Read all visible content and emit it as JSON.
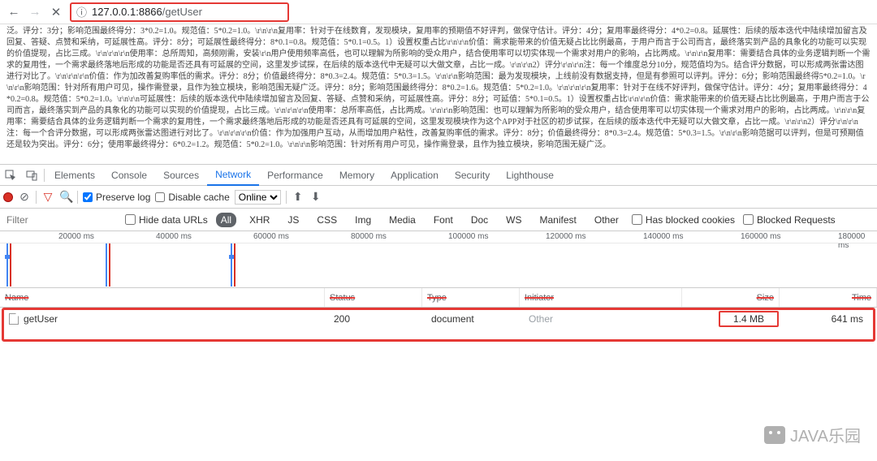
{
  "address_bar": {
    "url_host": "127.0.0.1",
    "url_port": ":8866",
    "url_path": "/getUser"
  },
  "page_content": "泛。评分：3分；影响范围最终得分：3*0.2=1.0。规范值：5*0.2=1.0。\\r\\n\\r\\n复用率：针对于在线数育，发现模块，复用率的预期值不好评判，做保守估计。评分：4分；复用率最终得分：4*0.2=0.8。延展性：后续的版本迭代中陆续增加留言及回复、答疑、点赞和采纳，可延展性高。评分：8分；可延展性最终得分：8*0.1=0.8。规范值：5*0.1=0.5。1）设置权重占比\\r\\n\\r\\n价值：需求能带来的价值无疑占比比例最高，于用户而言于公司而言，最终落实到产品的具象化的功能可以实现的价值提现，占比三成。\\r\\n\\r\\n\\r\\n使用率：总所周知，高频刚需，安装\\r\\n用户使用频率高低，也可以理解为所影响的受众用户，结合使用率可以切实体现一个需求对用户的影响，占比两成。\\r\\n\\r\\n复用率：需要结合具体的业务逻辑判断一个需求的复用性，一个需求最终落地后形成的功能是否还具有可延展的空间，这里发步试探，在后续的版本迭代中无疑可以大做文章，占比一成。\\r\\n\\r\\n2）评分\\r\\n\\r\\n注：每一个维度总分10分，规范值均为5。结合评分数据，可以形成两张雷达图进行对比了。\\r\\n\\r\\n\\r\\n价值：作为加改善复购率低的需求。评分：8分；价值最终得分：8*0.3=2.4。规范值：5*0.3=1.5。\\r\\n\\r\\n影响范围：最为发现模块，上线前没有数据支持，但是有参照可以评判。评分：6分；影响范围最终得5*0.2=1.0。\\r\\n\\r\\n影响范围：针对所有用户可见，操作需登录，且作为独立模块，影响范围无疑广泛。评分：8分；影响范围最终得分：8*0.2=1.6。规范值：5*0.2=1.0。\\r\\n\\r\\n\\r\\n复用率：针对于在线不好评判，做保守估计。评分：4分；复用率最终得分：4*0.2=0.8。规范值：5*0.2=1.0。\\r\\n\\r\\n可延展性：后续的版本迭代中陆续增加留言及回复、答疑、点赞和采纳，可延展性高。评分：8分；可延值：5*0.1=0.5。1）设置权重占比\\r\\n\\r\\n价值：需求能带来的价值无疑占比比例最高，于用户而言于公司而言，最终落实到产品的具象化的功能可以实现的价值提现，占比三成。\\r\\n\\r\\n\\r\\n使用率：总所率高低，占比两成。\\r\\n\\r\\n影响范围：也可以理解为所影响的受众用户，结合使用率可以切实体现一个需求对用户的影响，占比两成。\\r\\n\\r\\n复用率：需要结合具体的业务逻辑判断一个需求的复用性，一个需求最终落地后形成的功能是否还具有可延展的空间，这里发现模块作为这个APP对于社区的初步试探，在后续的版本迭代中无疑可以大做文章，占比一成。\\r\\n\\r\\n2）评分\\r\\n\\r\\n注：每一个合评分数据，可以形成两张雷达图进行对比了。\\r\\n\\r\\n\\r\\n价值：作为加强用户互动，从而增加用户粘性，改善复购率低的需求。评分：8分；价值最终得分：8*0.3=2.4。规范值：5*0.3=1.5。\\r\\n\\r\\n影响范据可以评判，但是可预期值还是较为突出。评分：6分；使用率最终得分：6*0.2=1.2。规范值：5*0.2=1.0。\\r\\n\\r\\n影响范围：针对所有用户可见，操作需登录，且作为独立模块，影响范围无疑广泛。",
  "devtools": {
    "tabs": [
      "Elements",
      "Console",
      "Sources",
      "Network",
      "Performance",
      "Memory",
      "Application",
      "Security",
      "Lighthouse"
    ],
    "active_tab": "Network",
    "toolbar": {
      "preserve_log_label": "Preserve log",
      "preserve_log_checked": true,
      "disable_cache_label": "Disable cache",
      "disable_cache_checked": false,
      "throttle": "Online"
    },
    "filter": {
      "placeholder": "Filter",
      "hide_data_urls_label": "Hide data URLs",
      "types": [
        "All",
        "XHR",
        "JS",
        "CSS",
        "Img",
        "Media",
        "Font",
        "Doc",
        "WS",
        "Manifest",
        "Other"
      ],
      "active_type": "All",
      "has_blocked_cookies_label": "Has blocked cookies",
      "blocked_requests_label": "Blocked Requests"
    },
    "timeline": {
      "ticks": [
        "20000 ms",
        "40000 ms",
        "60000 ms",
        "80000 ms",
        "100000 ms",
        "120000 ms",
        "140000 ms",
        "160000 ms",
        "180000 ms"
      ]
    },
    "network": {
      "headers": {
        "name": "Name",
        "status": "Status",
        "type": "Type",
        "initiator": "Initiator",
        "size": "Size",
        "time": "Time"
      },
      "rows": [
        {
          "name": "getUser",
          "status": "200",
          "type": "document",
          "initiator": "Other",
          "size": "1.4 MB",
          "time": "641 ms"
        }
      ]
    }
  },
  "watermark": "JAVA乐园"
}
